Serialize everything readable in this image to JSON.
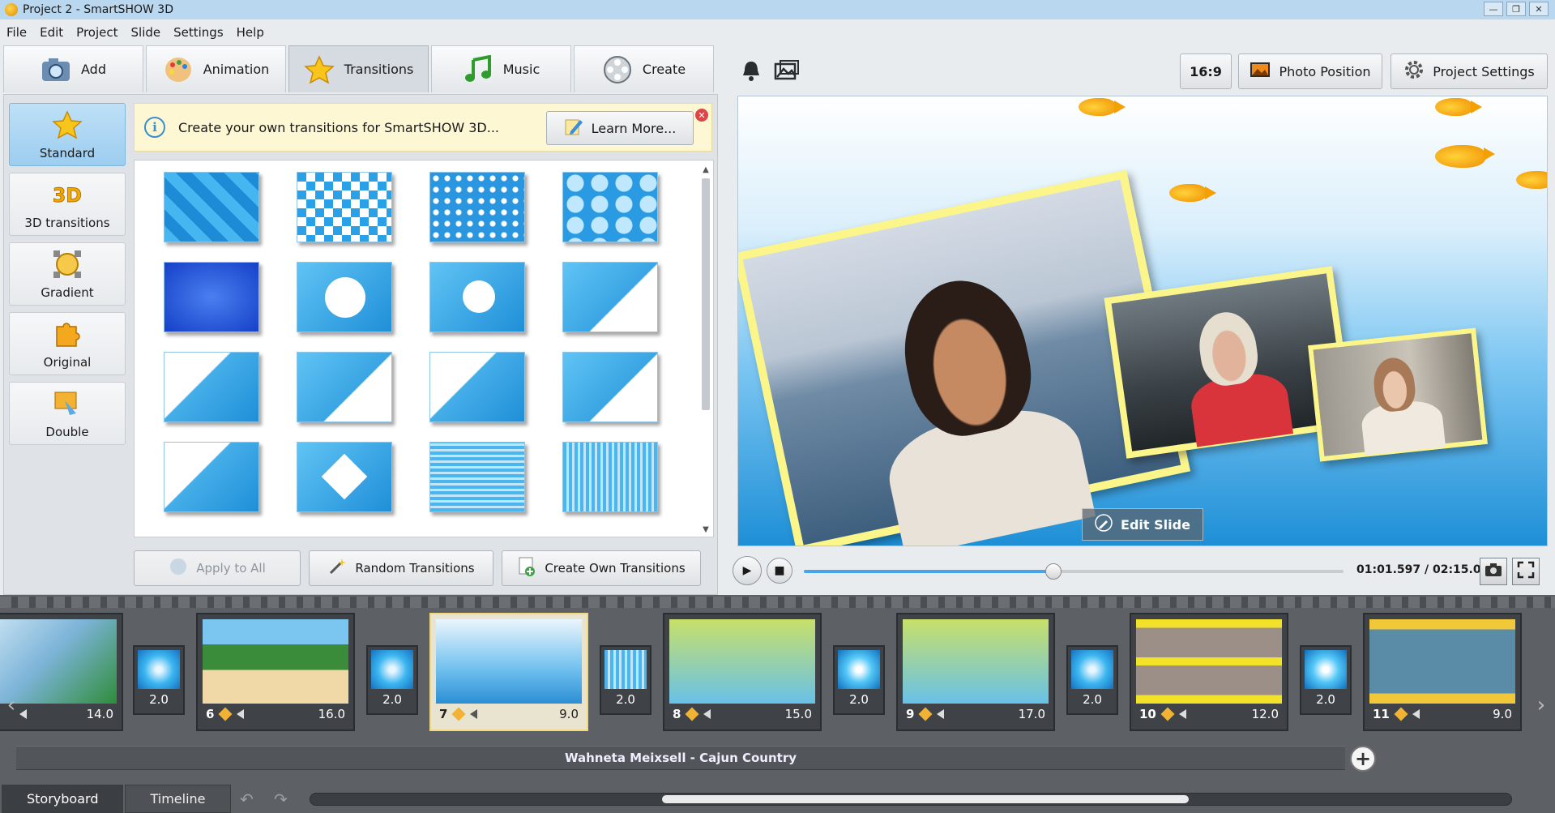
{
  "window": {
    "title": "Project 2 - SmartSHOW 3D"
  },
  "menu": [
    "File",
    "Edit",
    "Project",
    "Slide",
    "Settings",
    "Help"
  ],
  "tabs": [
    {
      "label": "Add",
      "icon": "camera-icon"
    },
    {
      "label": "Animation",
      "icon": "palette-icon"
    },
    {
      "label": "Transitions",
      "icon": "star-icon",
      "active": true
    },
    {
      "label": "Music",
      "icon": "music-note-icon"
    },
    {
      "label": "Create",
      "icon": "film-reel-icon"
    }
  ],
  "categories": [
    {
      "label": "Standard",
      "icon": "star-icon",
      "active": true
    },
    {
      "label": "3D transitions",
      "icon": "3d-icon"
    },
    {
      "label": "Gradient",
      "icon": "gradient-icon"
    },
    {
      "label": "Original",
      "icon": "puzzle-icon"
    },
    {
      "label": "Double",
      "icon": "double-icon"
    }
  ],
  "banner": {
    "text": "Create your own transitions for SmartSHOW 3D...",
    "button": "Learn More..."
  },
  "transition_grid": {
    "count_visible_rows": 4,
    "columns": 4
  },
  "actions": {
    "apply_all": "Apply to All",
    "random": "Random Transitions",
    "create_own": "Create Own Transitions"
  },
  "top_right": {
    "ratio": "16:9",
    "photo_position": "Photo Position",
    "project_settings": "Project Settings"
  },
  "preview": {
    "edit_slide": "Edit Slide"
  },
  "playback": {
    "time": "01:01.597 / 02:15.000",
    "progress_fraction": 0.456
  },
  "storyboard": {
    "slides": [
      {
        "num": "",
        "duration": "14.0"
      },
      {
        "num": "6",
        "duration": "16.0"
      },
      {
        "num": "7",
        "duration": "9.0",
        "selected": true
      },
      {
        "num": "8",
        "duration": "15.0"
      },
      {
        "num": "9",
        "duration": "17.0"
      },
      {
        "num": "10",
        "duration": "12.0"
      },
      {
        "num": "11",
        "duration": "9.0"
      }
    ],
    "transitions": [
      "2.0",
      "2.0",
      "2.0",
      "2.0",
      "2.0",
      "2.0",
      "2.0"
    ],
    "audio_track": "Wahneta Meixsell - Cajun Country"
  },
  "bottom_tabs": [
    "Storyboard",
    "Timeline"
  ]
}
